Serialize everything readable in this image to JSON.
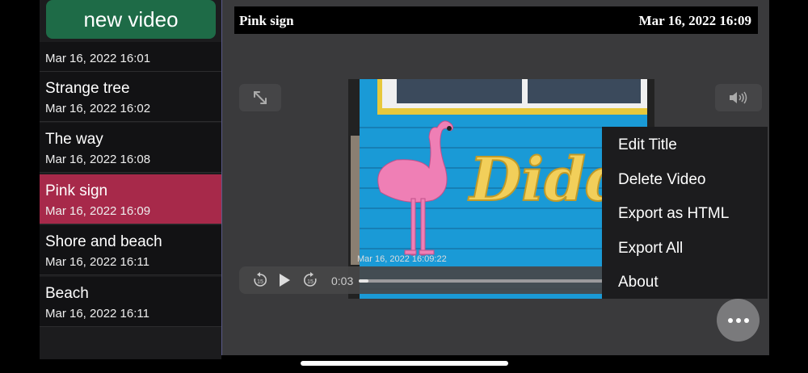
{
  "sidebar": {
    "new_video_label": "new video",
    "items": [
      {
        "title": "",
        "date": "Mar 16, 2022 16:01"
      },
      {
        "title": "Strange tree",
        "date": "Mar 16, 2022 16:02"
      },
      {
        "title": "The way",
        "date": "Mar 16, 2022 16:08"
      },
      {
        "title": "Pink sign",
        "date": "Mar 16, 2022 16:09",
        "selected": true
      },
      {
        "title": "Shore and beach",
        "date": "Mar 16, 2022 16:11"
      },
      {
        "title": "Beach",
        "date": "Mar 16, 2022 16:11"
      }
    ]
  },
  "header": {
    "title": "Pink sign",
    "datetime": "Mar 16, 2022 16:09"
  },
  "player": {
    "timestamp_overlay": "Mar 16, 2022 16:09:22",
    "current_time": "0:03",
    "progress": 0.03,
    "sign_text": "Didd"
  },
  "menu": {
    "items": [
      "Edit Title",
      "Delete Video",
      "Export as HTML",
      "Export All",
      "About"
    ]
  },
  "colors": {
    "accent_green": "#1e6b47",
    "selected": "#a7294a",
    "wall_blue": "#1a9ad6",
    "flamingo": "#ef7fb5",
    "sign_yellow": "#f2cf5a"
  },
  "icons": {
    "fullscreen": "expand-arrows-icon",
    "volume": "speaker-icon",
    "rewind": "skip-back-15-icon",
    "play": "play-icon",
    "forward": "skip-forward-15-icon",
    "more": "ellipsis-icon"
  }
}
